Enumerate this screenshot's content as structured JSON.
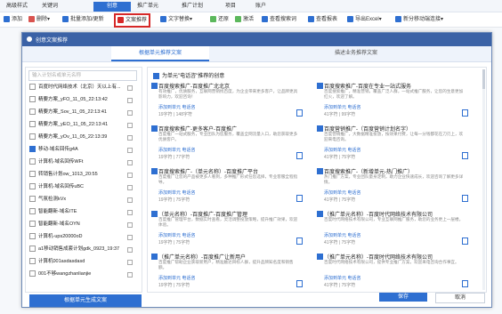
{
  "top_tabs": [
    {
      "label": "高级样式"
    },
    {
      "label": "关键词"
    },
    {
      "label": "创意"
    },
    {
      "label": "推广单元"
    },
    {
      "label": "推广计划"
    },
    {
      "label": "项目"
    },
    {
      "label": "账户"
    }
  ],
  "toolbar": [
    {
      "label": "添加",
      "color": "#2e6fd1"
    },
    {
      "label": "删除",
      "color": "#d9534f"
    },
    {
      "label": "批量添加/更新",
      "color": "#2e6fd1"
    },
    {
      "label": "文案推荐",
      "color": "#d62828"
    },
    {
      "label": "文字替换",
      "color": "#2e6fd1"
    },
    {
      "label": "还原",
      "color": "#5cb85c"
    },
    {
      "label": "激活",
      "color": "#5cb85c"
    },
    {
      "label": "查看搜索词",
      "color": "#2e6fd1"
    },
    {
      "label": "查看报表",
      "color": "#2e6fd1"
    },
    {
      "label": "导出Excel",
      "color": "#2e6fd1"
    },
    {
      "label": "新分移动端连接",
      "color": "#2e6fd1"
    }
  ],
  "modal": {
    "title": "创意文案推荐",
    "tabs": [
      "根据单元推荐文案",
      "描述业务推荐文案"
    ],
    "search_placeholder": "输入计划名或单元名称",
    "tree": [
      {
        "label": "百度时代网络技术（北京）天以上有...",
        "checked": false
      },
      {
        "label": "精要方案_yFO_11_05_22:13:42",
        "checked": false
      },
      {
        "label": "精要方案_Sov_11_05_22:13:41",
        "checked": false
      },
      {
        "label": "精要方案_yEO_11_05_22:13:41",
        "checked": false
      },
      {
        "label": "精要方案_yOv_11_05_22:13:39",
        "checked": false
      },
      {
        "label": "移动-域名回传g4A",
        "checked": true
      },
      {
        "label": "计算机-域名回传WFt",
        "checked": false
      },
      {
        "label": "转销售计划ow_1013_20:55",
        "checked": false
      },
      {
        "label": "计算机-域名回传uBC",
        "checked": false
      },
      {
        "label": "气氛检测kVx",
        "checked": false
      },
      {
        "label": "智能翻新-域名ITE",
        "checked": false
      },
      {
        "label": "智能翻新-域名OYN",
        "checked": false
      },
      {
        "label": "计算机-ups20000oD",
        "checked": false
      },
      {
        "label": "a1移动销售成套计划gdk_0923_19:37",
        "checked": false
      },
      {
        "label": "计算机001asdasdasd",
        "checked": false
      },
      {
        "label": "001不够wangzhanlianjie",
        "checked": false
      }
    ],
    "generate_button": "根据单元生成文案",
    "select_all_label": "为单元\"电话咨\"推荐的创意",
    "cards": [
      {
        "title": "百度搜索推广-百度推广北北京",
        "desc": "有效推广，优质服务，互联网营销找百度，为企业带来更多客户，让品牌更具影响力，欢迎咨询！",
        "links": "添加到单元  电话咨",
        "meta": "19字符 | 148字符",
        "checked": true
      },
      {
        "title": "百度搜索推广-百度在专业一站式服务",
        "desc": "百度搜索推广，精准营销，覆盖广泛人群，一站式推广服务，让您的生意更加红火，欢迎了解。",
        "links": "添加到单元  电话咨",
        "meta": "41字符 | 99字符",
        "checked": true
      },
      {
        "title": "百度搜索推广-更多客户-百度推广",
        "desc": "百度推广一站式服务，专业团队为您服务，覆盖全网流量入口，助您获取更多优质客户。",
        "links": "添加到单元  电话咨",
        "meta": "19字符 | 77字符",
        "checked": true
      },
      {
        "title": "百度营销推广-（百度营销计划名字）",
        "desc": "百度营销推广，大数据精准投放，按效果付费，让每一分钱都花在刀刃上，欢迎来电咨询。",
        "links": "添加到单元  电话咨",
        "meta": "41字符 | 75字符",
        "checked": true
      },
      {
        "title": "百度搜索推广-（单元名称）-百度推广平台",
        "desc": "百度推广让您的产品被更多人看到，多种推广形式任您选择，专业客服全程指导。",
        "links": "添加到单元  电话咨",
        "meta": "19字符 | 75字符",
        "checked": true
      },
      {
        "title": "百度搜索推广-（新增单元-热门推广）",
        "desc": "热门推广方案，专业团队量身定制，助力企业快速成长，欢迎咨询了解更多详情。",
        "links": "添加到单元  电话咨",
        "meta": "41字符 | 75字符",
        "checked": true
      },
      {
        "title": "（单元名称）-百度推广-百度推广管理",
        "desc": "百度推广管理平台，数据实时查看，灵活调整投放策略，提升推广效果，欢迎体验。",
        "links": "添加到单元  电话咨",
        "meta": "19字符 | 75字符",
        "checked": true
      },
      {
        "title": "（推广单元名称）-百度时代网络技术有限公司",
        "desc": "百度时代网络技术有限公司，专业互联网推广服务，助您的业务更上一层楼。",
        "links": "添加到单元  电话咨",
        "meta": "41字符 | 75字符",
        "checked": true
      },
      {
        "title": "（推广单元名称）-百度推广让新用户",
        "desc": "百度推广帮助企业获取新用户，精准触达目标人群，提升品牌知名度和销售额。",
        "links": "添加到单元  电话咨",
        "meta": "19字符 | 75字符",
        "checked": true
      },
      {
        "title": "（推广单元名称）-百度时代网络技术有限公司",
        "desc": "百度时代网络技术有限公司，提供专业推广方案，欢迎来电咨询合作事宜。",
        "links": "添加到单元  电话咨",
        "meta": "41字符 | 75字符",
        "checked": true
      }
    ],
    "save_button": "保存",
    "cancel_button": "取消"
  }
}
